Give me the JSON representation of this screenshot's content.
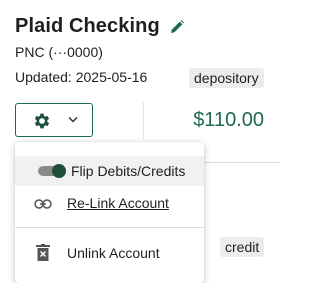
{
  "account": {
    "name": "Plaid Checking",
    "institution": "PNC (···0000)",
    "updated": "Updated: 2025-05-16",
    "type_badge": "depository",
    "balance": "$110.00"
  },
  "other_account": {
    "type_badge": "credit"
  },
  "menu": {
    "flip_label": "Flip Debits/Credits",
    "flip_on": true,
    "relink_label": "Re-Link Account",
    "unlink_label": "Unlink Account"
  },
  "colors": {
    "accent": "#1e6b4c",
    "toggle_knob": "#1e4f3b",
    "badge_bg": "#ececec"
  },
  "icons": [
    "pencil-icon",
    "gear-icon",
    "chevron-down-icon",
    "link-icon",
    "trash-icon"
  ]
}
